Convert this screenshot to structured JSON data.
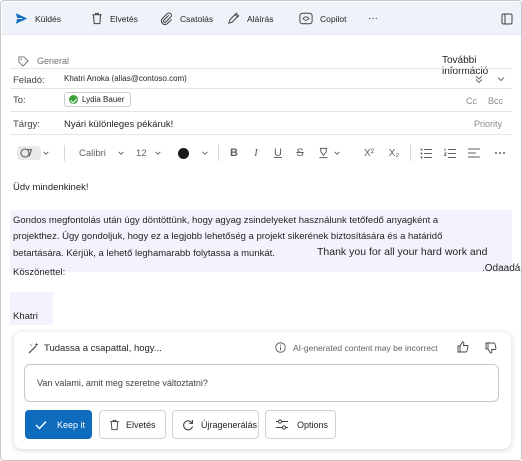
{
  "toolbar": {
    "send_label": "Küldés",
    "discard_label": "Elvetés",
    "attach_label": "Csatolás",
    "signature_label": "Aláírás",
    "copilot_label": "Copilot",
    "more_label": "···"
  },
  "header": {
    "sensitivity_label": "General",
    "more_info_label": "További információ",
    "from_label": "Feladó:",
    "from_value": "Khatri  Anoka  (alias@contoso.com)",
    "to_label": "To:",
    "to_recipient": "Lydia Bauer",
    "cc_label": "Cc",
    "bcc_label": "Bcc",
    "subject_label": "Tárgy:",
    "subject_value": "Nyári különleges pékáruk!",
    "priority_label": "Priority"
  },
  "format_bar": {
    "font_name": "Calibri",
    "font_size": "12",
    "bold": "B",
    "italic": "I",
    "underline": "U",
    "strikethrough": "S",
    "superscript": "X²",
    "subscript": "X₂",
    "text_color": "#1a1a1a"
  },
  "body": {
    "greeting": "Üdv mindenkinek!",
    "line1": "Gondos megfontolás után úgy döntöttünk, hogy agyag zsindelyeket használunk tetőfedő anyagként a",
    "line2": "projekthez. Úgy gondoljuk, hogy ez a legjobb lehetőség a projekt sikerének biztosítására és a határidő",
    "line3": "betartására. Kérjük, a lehető leghamarabb folytassa a munkát.",
    "thanks_en": "Thank you for all your hard work and",
    "dedication": ".Odaadás",
    "closing": "Köszönettel:",
    "signature": "Khatri"
  },
  "copilot": {
    "prompt_text": "Tudassa a csapattal, hogy...",
    "disclaimer": "AI-generated content may be incorrect",
    "input_placeholder": "Van valami, amit meg szeretne változtatni?",
    "keep_label": "Keep it",
    "discard_label": "Elvetés",
    "regenerate_label": "Újragenerálás",
    "options_label": "Options",
    "accent": "#0f6cbd"
  }
}
